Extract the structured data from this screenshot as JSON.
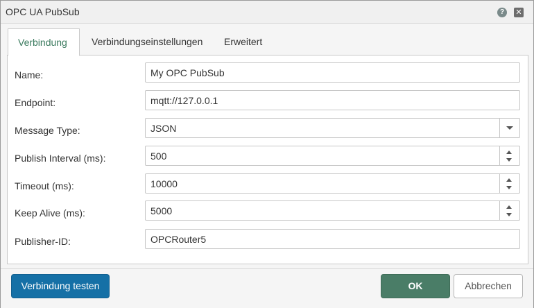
{
  "window": {
    "title": "OPC UA PubSub",
    "help_icon": "help-icon",
    "close_icon": "close-icon"
  },
  "tabs": [
    {
      "label": "Verbindung",
      "active": true
    },
    {
      "label": "Verbindungseinstellungen",
      "active": false
    },
    {
      "label": "Erweitert",
      "active": false
    }
  ],
  "form": {
    "name": {
      "label": "Name:",
      "value": "My OPC PubSub"
    },
    "endpoint": {
      "label": "Endpoint:",
      "value": "mqtt://127.0.0.1"
    },
    "message_type": {
      "label": "Message Type:",
      "value": "JSON"
    },
    "publish_interval": {
      "label": "Publish Interval (ms):",
      "value": "500"
    },
    "timeout": {
      "label": "Timeout (ms):",
      "value": "10000"
    },
    "keep_alive": {
      "label": "Keep Alive (ms):",
      "value": "5000"
    },
    "publisher_id": {
      "label": "Publisher-ID:",
      "value": "OPCRouter5"
    }
  },
  "footer": {
    "test_label": "Verbindung testen",
    "ok_label": "OK",
    "cancel_label": "Abbrechen"
  },
  "colors": {
    "accent_green": "#4a7d67",
    "active_tab_text": "#3a7a5e",
    "test_button_blue": "#1570a6"
  }
}
